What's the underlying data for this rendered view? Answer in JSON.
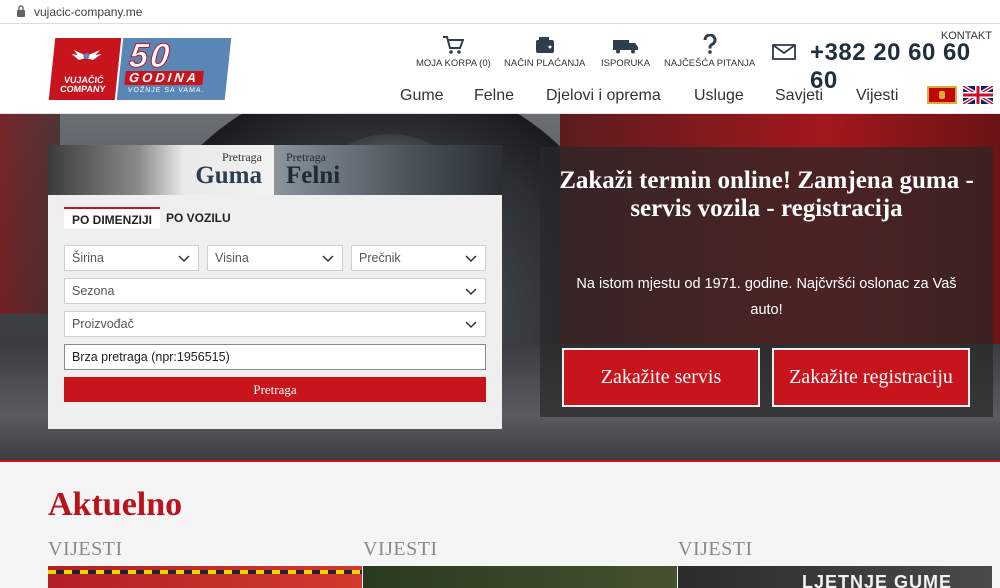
{
  "browser": {
    "url": "vujacic-company.me"
  },
  "logo": {
    "brand": "VUJAČIĆ COMPANY",
    "years": "50",
    "godina": "GODINA",
    "slogan": "VOŽNJE SA VAMA."
  },
  "header": {
    "tools": [
      {
        "label": "MOJA KORPA (0)",
        "icon": "cart-icon"
      },
      {
        "label": "NAČIN PLAĆANJA",
        "icon": "wallet-icon"
      },
      {
        "label": "ISPORUKA",
        "icon": "truck-icon"
      },
      {
        "label": "NAJČEŠĆA PITANJA",
        "icon": "question-icon"
      }
    ],
    "contact_label": "KONTAKT",
    "phone": "+382 20 60 60 60"
  },
  "nav": {
    "items": [
      "Gume",
      "Felne",
      "Djelovi i oprema",
      "Usluge",
      "Savjeti",
      "Vijesti"
    ]
  },
  "languages": [
    "ME",
    "EN"
  ],
  "search": {
    "tab_guma": {
      "line1": "Pretraga",
      "line2": "Guma"
    },
    "tab_felni": {
      "line1": "Pretraga",
      "line2": "Felni"
    },
    "mode_tabs": [
      "PO DIMENZIJI",
      "PO VOZILU"
    ],
    "selects": {
      "width": "Širina",
      "height": "Visina",
      "diameter": "Prečnik",
      "season": "Sezona",
      "manufacturer": "Proizvođač"
    },
    "quick_value": "Brza pretraga (npr:1956515)",
    "button": "Pretraga"
  },
  "promo": {
    "title": "Zakaži termin online! Zamjena guma - servis vozila - registracija",
    "subtitle": "Na istom mjestu od 1971. godine. Najčvršći oslonac za Vaš auto!",
    "button_service": "Zakažite servis",
    "button_registration": "Zakažite registraciju"
  },
  "news": {
    "heading": "Aktuelno",
    "categories": [
      "VIJESTI",
      "VIJESTI",
      "VIJESTI"
    ],
    "thumb3_text": "LJETNJE GUME"
  },
  "colors": {
    "brand_red": "#c8151d",
    "brand_blue": "#5a86b5"
  }
}
